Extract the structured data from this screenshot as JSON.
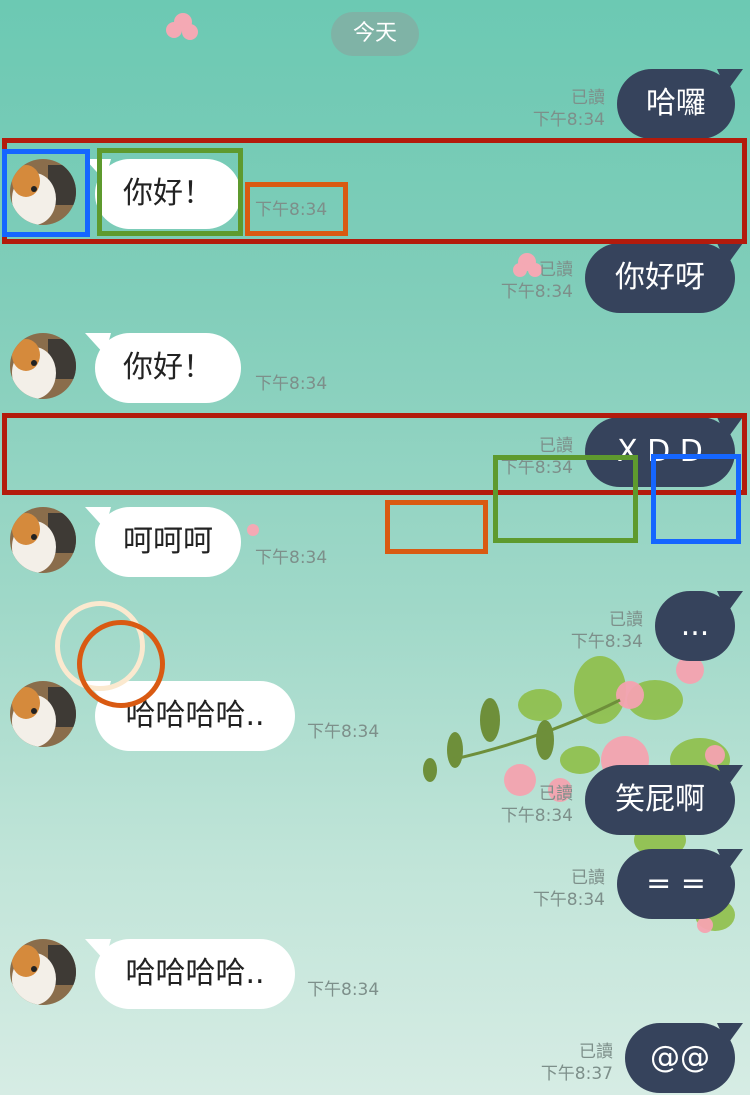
{
  "date_chip": "今天",
  "read_label": "已讀",
  "messages": [
    {
      "side": "out",
      "text": "哈囉",
      "time": "下午8:34",
      "read": "已讀"
    },
    {
      "side": "in",
      "text": "你好！",
      "time": "下午8:34"
    },
    {
      "side": "out",
      "text": "你好呀",
      "time": "下午8:34",
      "read": "已讀"
    },
    {
      "side": "in",
      "text": "你好！",
      "time": "下午8:34"
    },
    {
      "side": "out",
      "text": "X D D",
      "time": "下午8:34",
      "read": "已讀"
    },
    {
      "side": "in",
      "text": "呵呵呵",
      "time": "下午8:34"
    },
    {
      "side": "out",
      "text": "...",
      "time": "下午8:34",
      "read": "已讀"
    },
    {
      "side": "in",
      "text": "哈哈哈哈..",
      "time": "下午8:34"
    },
    {
      "side": "out",
      "text": "笑屁啊",
      "time": "下午8:34",
      "read": "已讀"
    },
    {
      "side": "out",
      "text": "= =",
      "time": "下午8:34",
      "read": "已讀"
    },
    {
      "side": "in",
      "text": "哈哈哈哈..",
      "time": "下午8:34"
    },
    {
      "side": "out",
      "text": "@@",
      "time": "下午8:37",
      "read": "已讀"
    }
  ],
  "colors": {
    "outgoing_bubble": "#36435c",
    "incoming_bubble": "#ffffff",
    "annotation_red": "#b31b0c",
    "annotation_blue": "#1566ff",
    "annotation_green": "#5e9a2e",
    "annotation_orange": "#d95a12",
    "annotation_cream": "#fbe9cf"
  },
  "icons": {
    "avatar": "shiba-dog-avatar"
  }
}
